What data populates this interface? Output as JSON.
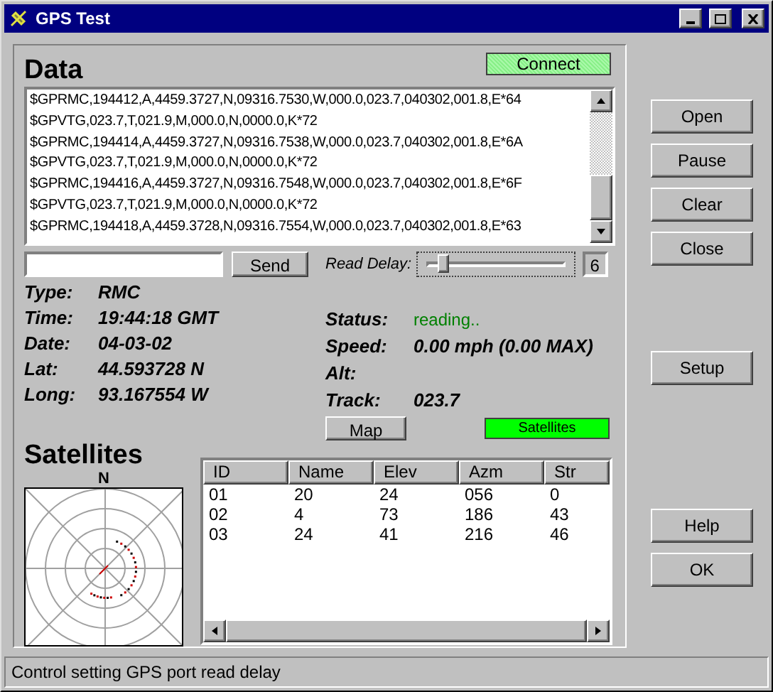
{
  "window": {
    "title": "GPS Test"
  },
  "data_panel": {
    "heading": "Data",
    "connect": {
      "label": "Connect",
      "on": true
    },
    "log_lines": [
      "$GPRMC,194412,A,4459.3727,N,09316.7530,W,000.0,023.7,040302,001.8,E*64",
      "$GPVTG,023.7,T,021.9,M,000.0,N,0000.0,K*72",
      "$GPRMC,194414,A,4459.3727,N,09316.7538,W,000.0,023.7,040302,001.8,E*6A",
      "$GPVTG,023.7,T,021.9,M,000.0,N,0000.0,K*72",
      "$GPRMC,194416,A,4459.3727,N,09316.7548,W,000.0,023.7,040302,001.8,E*6F",
      "$GPVTG,023.7,T,021.9,M,000.0,N,0000.0,K*72",
      "$GPRMC,194418,A,4459.3728,N,09316.7554,W,000.0,023.7,040302,001.8,E*63"
    ],
    "send_button": {
      "label": "Send"
    },
    "read_delay": {
      "label": "Read Delay:",
      "level": 0.1,
      "reading": "6"
    },
    "fix_fields": [
      {
        "label": "Type:",
        "value": "RMC"
      },
      {
        "label": "Time:",
        "value": "19:44:18 GMT"
      },
      {
        "label": "Date:",
        "value": "04-03-02"
      },
      {
        "label": "Lat:",
        "value": "44.593728 N"
      },
      {
        "label": "Long:",
        "value": "93.167554 W"
      }
    ],
    "status_fields": [
      {
        "label": "Status:",
        "value": "reading..",
        "kind": "status"
      },
      {
        "label": "Speed:",
        "value": "0.00 mph (0.00 MAX)",
        "kind": "plain"
      },
      {
        "label": "Alt:",
        "kind": "plain"
      },
      {
        "label": "Track:",
        "value": "023.7",
        "kind": "plain"
      }
    ],
    "map_button": {
      "label": "Map"
    },
    "satellites_indicator": {
      "label": "Satellites",
      "on": true
    }
  },
  "satellites_panel": {
    "heading": "Satellites",
    "north_label": "N",
    "table": {
      "columns": [
        "ID",
        "Name",
        "Elev",
        "Azm",
        "Str"
      ],
      "rows": [
        [
          "01",
          "20",
          "24",
          "056",
          "0"
        ],
        [
          "02",
          "4",
          "73",
          "186",
          "43"
        ],
        [
          "03",
          "24",
          "41",
          "216",
          "46"
        ]
      ]
    }
  },
  "buttons": [
    {
      "label": "Open"
    },
    {
      "label": "Pause"
    },
    {
      "label": "Clear"
    },
    {
      "label": "Close"
    },
    {
      "label": "Setup"
    },
    {
      "label": "Help"
    },
    {
      "label": "OK"
    }
  ],
  "status_bar": {
    "text": "Control setting GPS port read delay"
  }
}
